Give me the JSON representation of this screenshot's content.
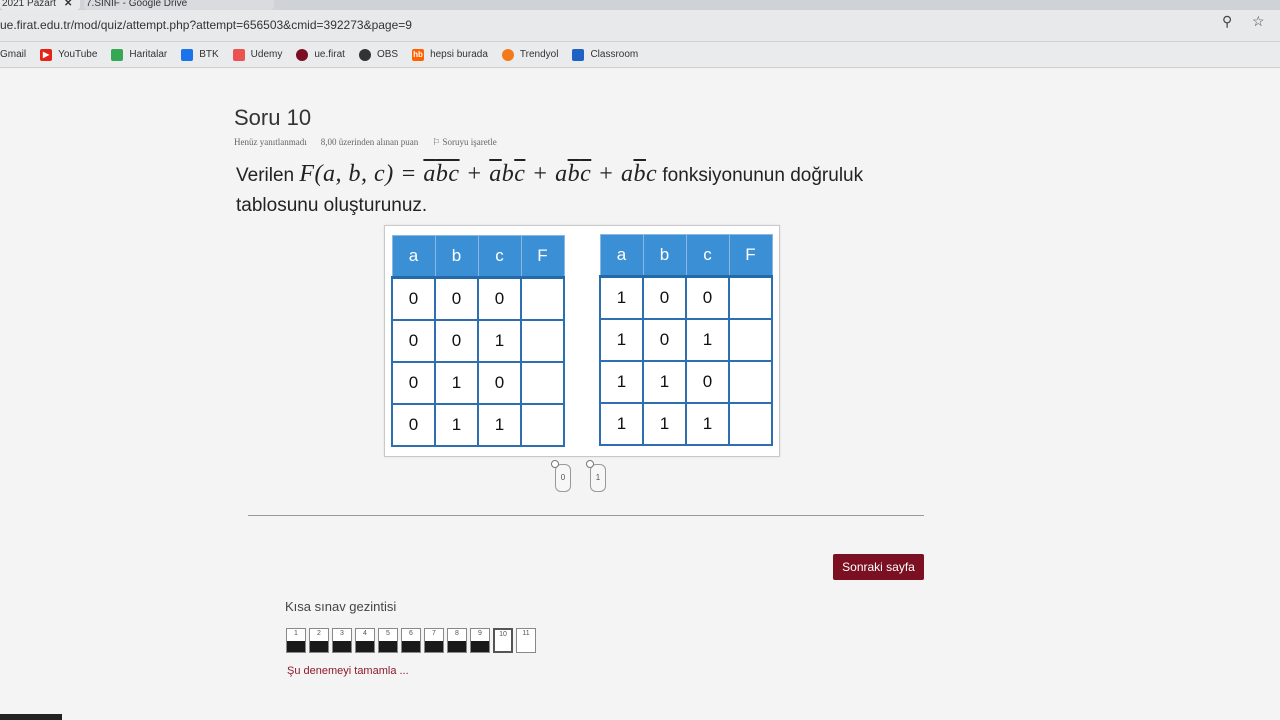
{
  "browser": {
    "tabs": [
      {
        "label": "2021 Pazart",
        "close": "✕"
      },
      {
        "label": "7.SINIF - Google Drive"
      }
    ],
    "url": "ue.firat.edu.tr/mod/quiz/attempt.php?attempt=656503&cmid=392273&page=9",
    "bookmarks": [
      "Gmail",
      "YouTube",
      "Haritalar",
      "BTK",
      "Udemy",
      "ue.firat",
      "OBS",
      "hepsi burada",
      "Trendyol",
      "Classroom"
    ]
  },
  "question": {
    "title": "Soru 10",
    "status": "Henüz yanıtlanmadı",
    "points": "8,00 üzerinden alınan puan",
    "flag": "Soruyu işaretle",
    "text_before": "Verilen",
    "text_after": "fonksiyonunun doğruluk tablosunu oluşturunuz."
  },
  "truth_tables": {
    "headers": [
      "a",
      "b",
      "c",
      "F"
    ],
    "left_rows": [
      [
        "0",
        "0",
        "0",
        ""
      ],
      [
        "0",
        "0",
        "1",
        ""
      ],
      [
        "0",
        "1",
        "0",
        ""
      ],
      [
        "0",
        "1",
        "1",
        ""
      ]
    ],
    "right_rows": [
      [
        "1",
        "0",
        "0",
        ""
      ],
      [
        "1",
        "0",
        "1",
        ""
      ],
      [
        "1",
        "1",
        "0",
        ""
      ],
      [
        "1",
        "1",
        "1",
        ""
      ]
    ]
  },
  "drag_items": [
    "0",
    "1"
  ],
  "next_button": "Sonraki sayfa",
  "navigation": {
    "title": "Kısa sınav gezintisi",
    "pages": [
      {
        "n": "1",
        "answered": true
      },
      {
        "n": "2",
        "answered": true
      },
      {
        "n": "3",
        "answered": true
      },
      {
        "n": "4",
        "answered": true
      },
      {
        "n": "5",
        "answered": true
      },
      {
        "n": "6",
        "answered": true
      },
      {
        "n": "7",
        "answered": true
      },
      {
        "n": "8",
        "answered": true
      },
      {
        "n": "9",
        "answered": true
      },
      {
        "n": "10",
        "answered": false,
        "current": true
      },
      {
        "n": "11",
        "answered": false
      }
    ],
    "finish": "Şu denemeyi tamamla ..."
  }
}
